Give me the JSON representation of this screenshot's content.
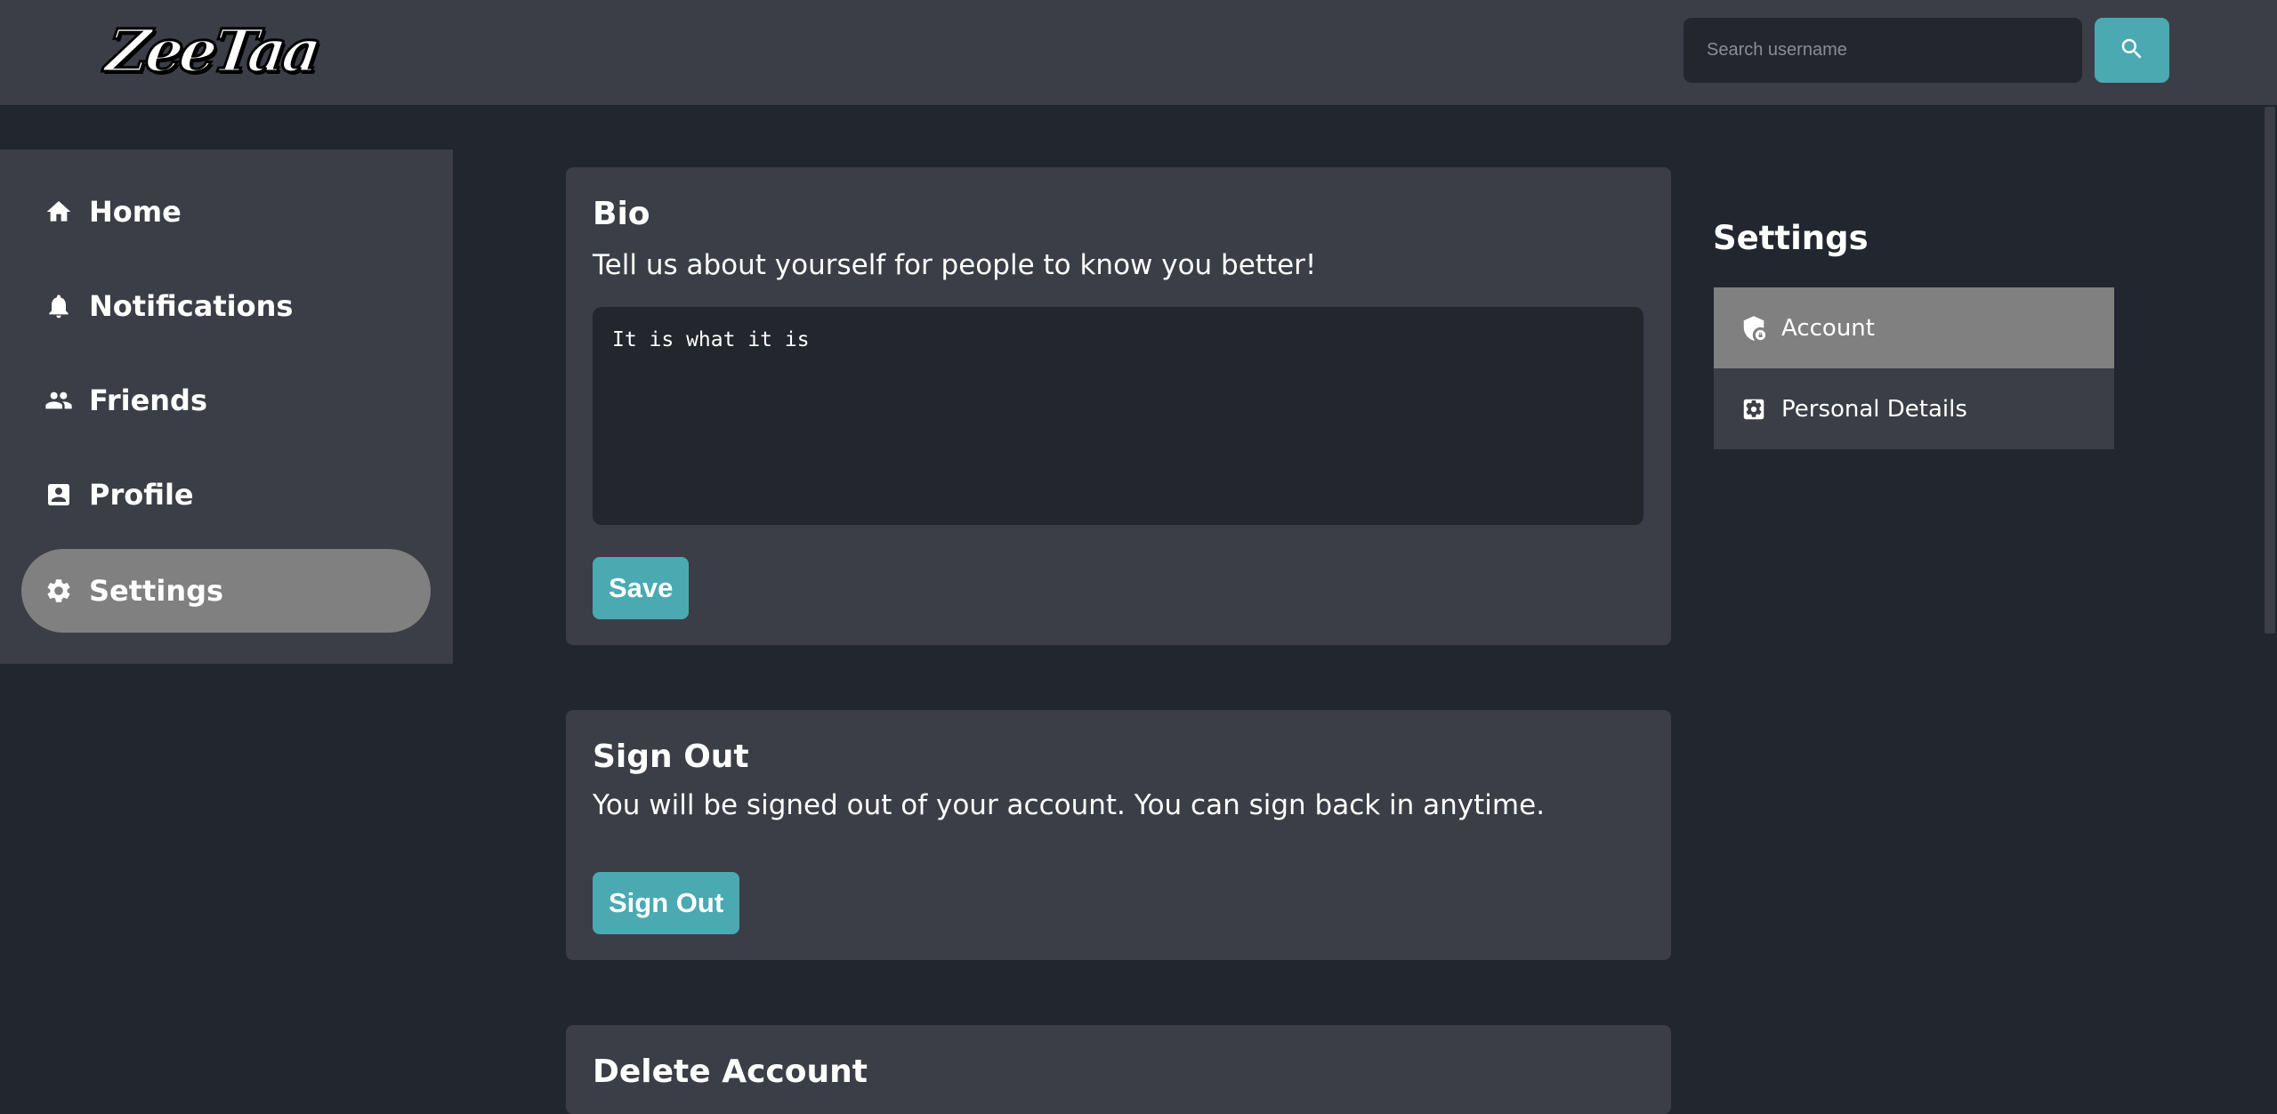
{
  "header": {
    "logo_text": "ZeeTaa",
    "search": {
      "placeholder": "Search username",
      "value": ""
    },
    "search_button_icon": "search-icon"
  },
  "sidebar": {
    "items": [
      {
        "label": "Home",
        "icon": "home-icon",
        "active": false
      },
      {
        "label": "Notifications",
        "icon": "bell-icon",
        "active": false
      },
      {
        "label": "Friends",
        "icon": "people-icon",
        "active": false
      },
      {
        "label": "Profile",
        "icon": "profile-card-icon",
        "active": false
      },
      {
        "label": "Settings",
        "icon": "gear-icon",
        "active": true
      }
    ]
  },
  "main": {
    "bio": {
      "title": "Bio",
      "description": "Tell us about yourself for people to know you better!",
      "value": "It is what it is",
      "save_label": "Save"
    },
    "sign_out": {
      "title": "Sign Out",
      "description": "You will be signed out of your account. You can sign back in anytime.",
      "button_label": "Sign Out"
    },
    "delete_account": {
      "title": "Delete Account"
    }
  },
  "settings_panel": {
    "title": "Settings",
    "items": [
      {
        "label": "Account",
        "icon": "shield-lock-icon",
        "active": true
      },
      {
        "label": "Personal Details",
        "icon": "settings-box-icon",
        "active": false
      }
    ]
  },
  "colors": {
    "background": "#22262e",
    "panel": "#3b3e46",
    "accent": "#4aa9b1",
    "active_item": "#808080",
    "input_bg": "#23262d"
  }
}
